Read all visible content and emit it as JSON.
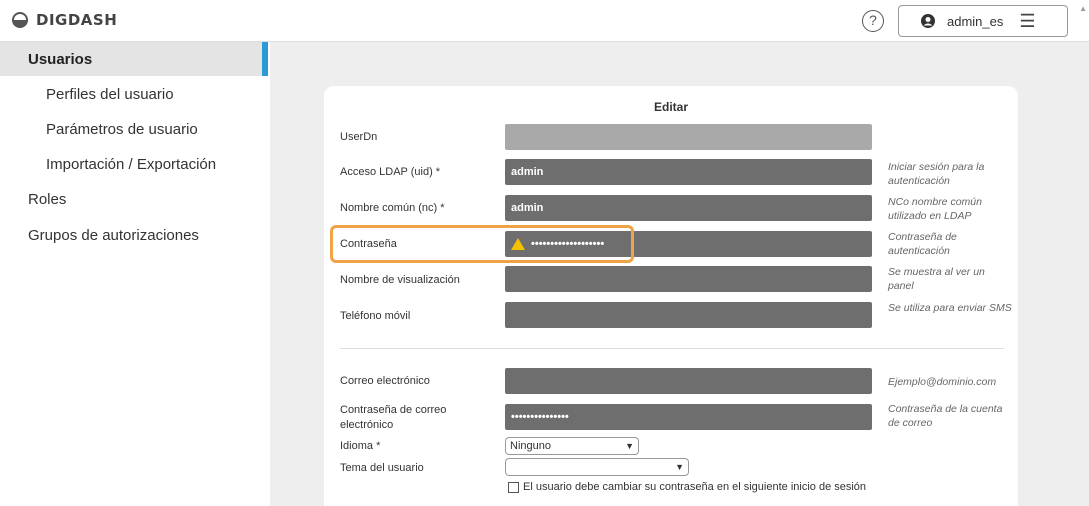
{
  "header": {
    "brand": "DIGDASH",
    "help_symbol": "?",
    "user_name": "admin_es",
    "menu_symbol": "☰"
  },
  "sidebar": {
    "items": [
      {
        "label": "Usuarios",
        "active": true
      },
      {
        "label": "Perfiles del usuario"
      },
      {
        "label": "Parámetros de usuario"
      },
      {
        "label": "Importación / Exportación"
      },
      {
        "label": "Roles"
      },
      {
        "label": "Grupos de autorizaciones"
      }
    ]
  },
  "form": {
    "title": "Editar",
    "fields": [
      {
        "label": "UserDn",
        "value": "",
        "hint": ""
      },
      {
        "label": "Acceso LDAP (uid) *",
        "value": "admin",
        "hint": "Iniciar sesión para la autenticación"
      },
      {
        "label": "Nombre común (nc) *",
        "value": "admin",
        "hint": "NCo nombre común utilizado en LDAP"
      },
      {
        "label": "Contraseña",
        "value": "•••••••••••••••••••",
        "hint": "Contraseña de autenticación"
      },
      {
        "label": "Nombre de visualización",
        "value": "",
        "hint": "Se muestra al ver un panel"
      },
      {
        "label": "Teléfono móvil",
        "value": "",
        "hint": "Se utiliza para enviar SMS"
      },
      {
        "label": "Correo electrónico",
        "value": "",
        "hint": "Ejemplo@dominio.com"
      },
      {
        "label": "Contraseña de correo electrónico",
        "value": "•••••••••••••••",
        "hint": "Contraseña de la cuenta de correo"
      }
    ],
    "language": {
      "label": "Idioma *",
      "selected": "Ninguno"
    },
    "theme": {
      "label": "Tema del usuario",
      "selected": ""
    },
    "change_password_label": "El usuario debe cambiar su contraseña en el siguiente inicio de sesión"
  },
  "colors": {
    "accent": "#2b9bd8",
    "highlight": "#f0a246",
    "input_dark": "#6e6e6e",
    "warning": "#f2c200"
  }
}
